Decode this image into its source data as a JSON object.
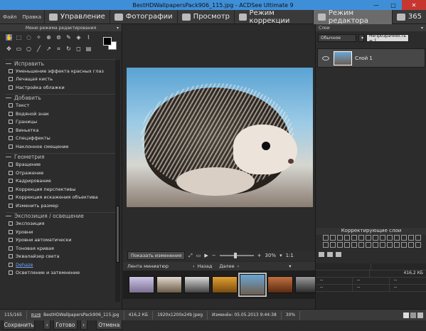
{
  "title": "BestHDWallpapersPack906_115.jpg - ACDSee Ultimate 9",
  "menu": {
    "file": "Файл",
    "edit": "Правка"
  },
  "modes": [
    {
      "label": "Управление"
    },
    {
      "label": "Фотографии"
    },
    {
      "label": "Просмотр"
    },
    {
      "label": "Режим коррекции"
    },
    {
      "label": "Режим редактора"
    }
  ],
  "badge_365": "365",
  "left_panel": {
    "header": "Меню режима редактирования",
    "sections": [
      {
        "title": "Исправить",
        "items": [
          "Уменьшение эффекта красных глаз",
          "Лечащая кисть",
          "Настройка облажки"
        ]
      },
      {
        "title": "Добавить",
        "items": [
          "Текст",
          "Водяной знак",
          "Границы",
          "Виньетка",
          "Спецэффекты",
          "Наклонное смещение"
        ]
      },
      {
        "title": "Геометрия",
        "items": [
          "Вращение",
          "Отражение",
          "Кадрирование",
          "Коррекция перспективы",
          "Коррекция искажения объектива",
          "Изменить размер"
        ]
      },
      {
        "title": "Экспозиция / освещение",
        "items": [
          "Экспозиция",
          "Уровни",
          "Уровни автоматически",
          "Тоновая кривая",
          "Эквалайзер света",
          "Dehaze",
          "Осветление и затемнение"
        ]
      }
    ],
    "buttons": {
      "save": "Сохранить",
      "done": "Готово",
      "cancel": "Отмена"
    }
  },
  "view": {
    "show_changes": "Показать изменения",
    "zoom": "30%",
    "ratio": "1:1"
  },
  "filmstrip": {
    "label": "Лента миниатюр",
    "back": "Назад",
    "next": "Далее"
  },
  "right_panel": {
    "header": "Слои",
    "blend": "Обычное",
    "opacity": "Непрозрачность = 1",
    "layer_name": "Слой 1",
    "adjust_title": "Корректирующие слои",
    "filesize": "416,2 КБ",
    "dash": "--"
  },
  "status": {
    "count": "115/165",
    "type": "JPG",
    "file": "BestHDWallpapersPack906_115.jpg",
    "size": "416,2 КБ",
    "dims": "1920x1200x24b jpeg",
    "modified": "Изменён: 05.05.2013 9:44:38",
    "zoom": "30%"
  }
}
